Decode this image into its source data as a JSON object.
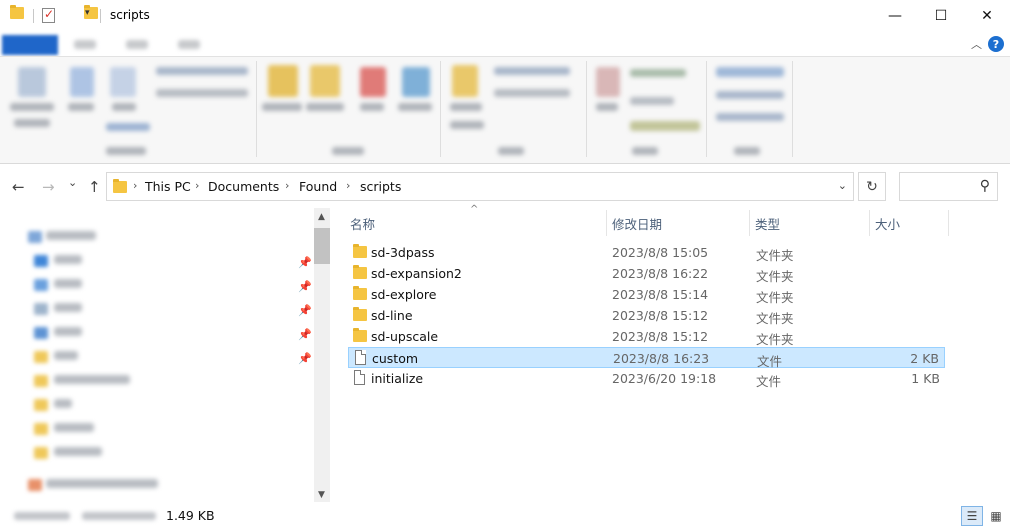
{
  "window": {
    "title": "scripts",
    "minimize_glyph": "—",
    "maximize_glyph": "☐",
    "close_glyph": "✕"
  },
  "icons": {
    "folder_color": "#f5c542",
    "help": "?",
    "collapse": "︿",
    "back": "←",
    "forward": "→",
    "recent": "⌄",
    "up": "↑",
    "chevron": "›",
    "dropdown": "⌄",
    "refresh": "↻",
    "search": "⚲",
    "pin": "📌",
    "scroll_up": "▲",
    "scroll_down": "▼",
    "details_view": "☰",
    "large_icons_view": "▦",
    "sort_caret": "^"
  },
  "address": {
    "crumbs": [
      "This PC",
      "Documents",
      "Found",
      "scripts"
    ]
  },
  "columns": {
    "name": "名称",
    "date": "修改日期",
    "type": "类型",
    "size": "大小"
  },
  "files": [
    {
      "name": "sd-3dpass",
      "date": "2023/8/8 15:05",
      "type": "文件夹",
      "size": "",
      "kind": "folder"
    },
    {
      "name": "sd-expansion2",
      "date": "2023/8/8 16:22",
      "type": "文件夹",
      "size": "",
      "kind": "folder"
    },
    {
      "name": "sd-explore",
      "date": "2023/8/8 15:14",
      "type": "文件夹",
      "size": "",
      "kind": "folder"
    },
    {
      "name": "sd-line",
      "date": "2023/8/8 15:12",
      "type": "文件夹",
      "size": "",
      "kind": "folder"
    },
    {
      "name": "sd-upscale",
      "date": "2023/8/8 15:12",
      "type": "文件夹",
      "size": "",
      "kind": "folder"
    },
    {
      "name": "custom",
      "date": "2023/8/8 16:23",
      "type": "文件",
      "size": "2 KB",
      "kind": "file",
      "selected": true
    },
    {
      "name": "initialize",
      "date": "2023/6/20 19:18",
      "type": "文件",
      "size": "1 KB",
      "kind": "file"
    }
  ],
  "status": {
    "selection_size": "1.49 KB"
  },
  "colors": {
    "accent": "#1f66c9",
    "selection_bg": "#cce8ff",
    "selection_border": "#99d1ff"
  }
}
